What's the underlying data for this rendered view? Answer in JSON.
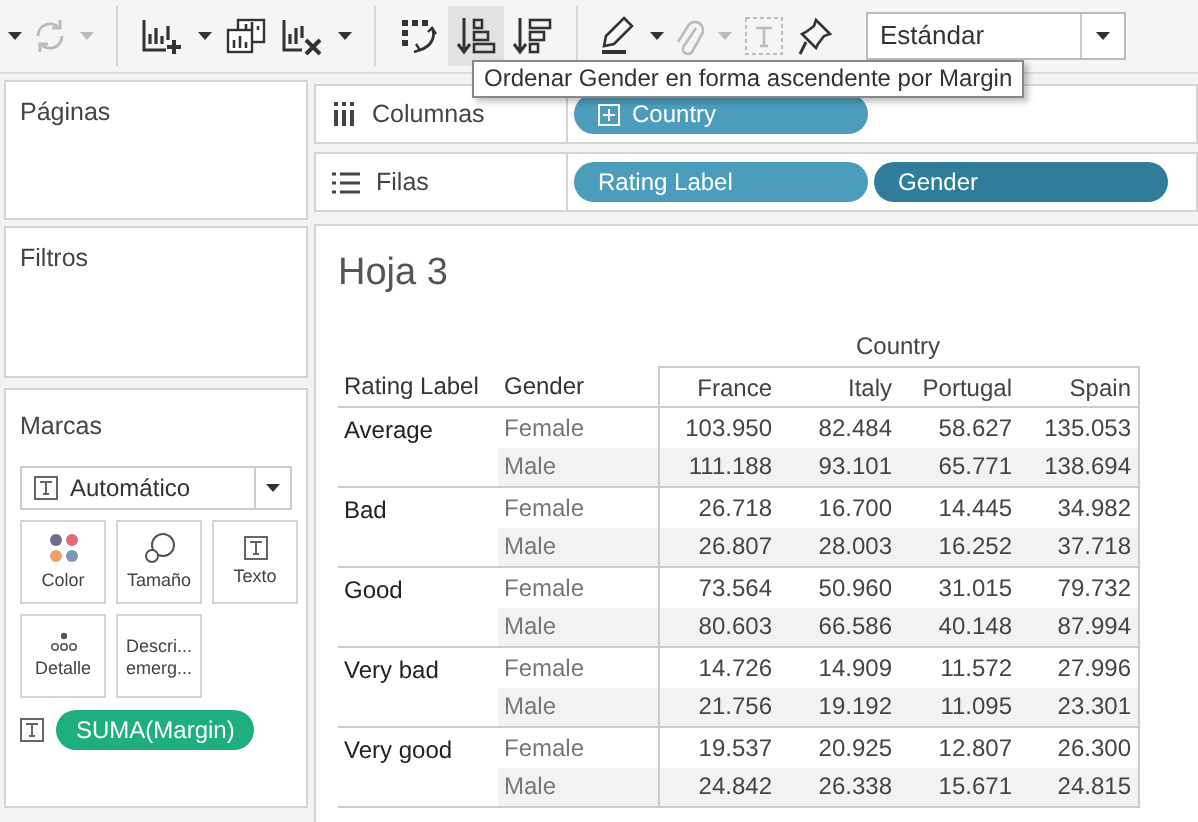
{
  "toolbar": {
    "buttons": [
      [
        {
          "kind": "caret",
          "disabled": false,
          "selected": false
        },
        {
          "kind": "refresh",
          "disabled": true,
          "selected": false
        },
        {
          "kind": "caret",
          "disabled": true,
          "selected": false
        }
      ],
      [
        {
          "kind": "new-chart",
          "disabled": false,
          "selected": false
        },
        {
          "kind": "caret",
          "disabled": false,
          "selected": false
        },
        {
          "kind": "duplicate-chart",
          "disabled": false,
          "selected": false
        },
        {
          "kind": "clear-chart",
          "disabled": false,
          "selected": false
        },
        {
          "kind": "caret",
          "disabled": false,
          "selected": false
        }
      ],
      [
        {
          "kind": "swap",
          "disabled": false,
          "selected": false
        },
        {
          "kind": "sort-asc",
          "disabled": false,
          "selected": true
        },
        {
          "kind": "sort-desc",
          "disabled": false,
          "selected": false
        }
      ],
      [
        {
          "kind": "highlight",
          "disabled": false,
          "selected": false
        },
        {
          "kind": "caret",
          "disabled": false,
          "selected": false
        },
        {
          "kind": "clip",
          "disabled": true,
          "selected": false
        },
        {
          "kind": "caret",
          "disabled": true,
          "selected": false
        },
        {
          "kind": "label",
          "disabled": true,
          "selected": false
        },
        {
          "kind": "pin",
          "disabled": false,
          "selected": false
        }
      ]
    ],
    "view_select": {
      "value": "Estándar"
    }
  },
  "tooltip": {
    "text": "Ordenar Gender en forma ascendente por Margin"
  },
  "left_panel": {
    "pages": {
      "title": "Páginas"
    },
    "filters": {
      "title": "Filtros"
    },
    "marks": {
      "title": "Marcas",
      "mark_type": "Automático",
      "cards": [
        {
          "kind": "color",
          "label": "Color"
        },
        {
          "kind": "size",
          "label": "Tamaño"
        },
        {
          "kind": "text",
          "label": "Texto"
        },
        {
          "kind": "detail",
          "label": "Detalle"
        },
        {
          "kind": "tooltip",
          "label": "Descri... emerg..."
        }
      ],
      "fields": [
        {
          "kind": "text",
          "label": "SUMA(Margin)"
        }
      ]
    }
  },
  "shelves": [
    {
      "kind": "columns",
      "label": "Columnas",
      "pills": [
        {
          "label": "Country",
          "selected": false
        }
      ]
    },
    {
      "kind": "rows",
      "label": "Filas",
      "pills": [
        {
          "label": "Rating Label",
          "selected": false
        },
        {
          "label": "Gender",
          "selected": true
        }
      ]
    }
  ],
  "sheet": {
    "title": "Hoja 3",
    "column_header": "Country",
    "row_headers": [
      "Rating Label",
      "Gender"
    ],
    "columns": [
      "France",
      "Italy",
      "Portugal",
      "Spain"
    ],
    "groups": [
      {
        "label": "Average",
        "rows": [
          {
            "gender": "Female",
            "values": [
              "103.950",
              "82.484",
              "58.627",
              "135.053"
            ]
          },
          {
            "gender": "Male",
            "values": [
              "111.188",
              "93.101",
              "65.771",
              "138.694"
            ]
          }
        ]
      },
      {
        "label": "Bad",
        "rows": [
          {
            "gender": "Female",
            "values": [
              "26.718",
              "16.700",
              "14.445",
              "34.982"
            ]
          },
          {
            "gender": "Male",
            "values": [
              "26.807",
              "28.003",
              "16.252",
              "37.718"
            ]
          }
        ]
      },
      {
        "label": "Good",
        "rows": [
          {
            "gender": "Female",
            "values": [
              "73.564",
              "50.960",
              "31.015",
              "79.732"
            ]
          },
          {
            "gender": "Male",
            "values": [
              "80.603",
              "66.586",
              "40.148",
              "87.994"
            ]
          }
        ]
      },
      {
        "label": "Very bad",
        "rows": [
          {
            "gender": "Female",
            "values": [
              "14.726",
              "14.909",
              "11.572",
              "27.996"
            ]
          },
          {
            "gender": "Male",
            "values": [
              "21.756",
              "19.192",
              "11.095",
              "23.301"
            ]
          }
        ]
      },
      {
        "label": "Very good",
        "rows": [
          {
            "gender": "Female",
            "values": [
              "19.537",
              "20.925",
              "12.807",
              "26.300"
            ]
          },
          {
            "gender": "Male",
            "values": [
              "24.842",
              "26.338",
              "15.671",
              "24.815"
            ]
          }
        ]
      }
    ]
  }
}
